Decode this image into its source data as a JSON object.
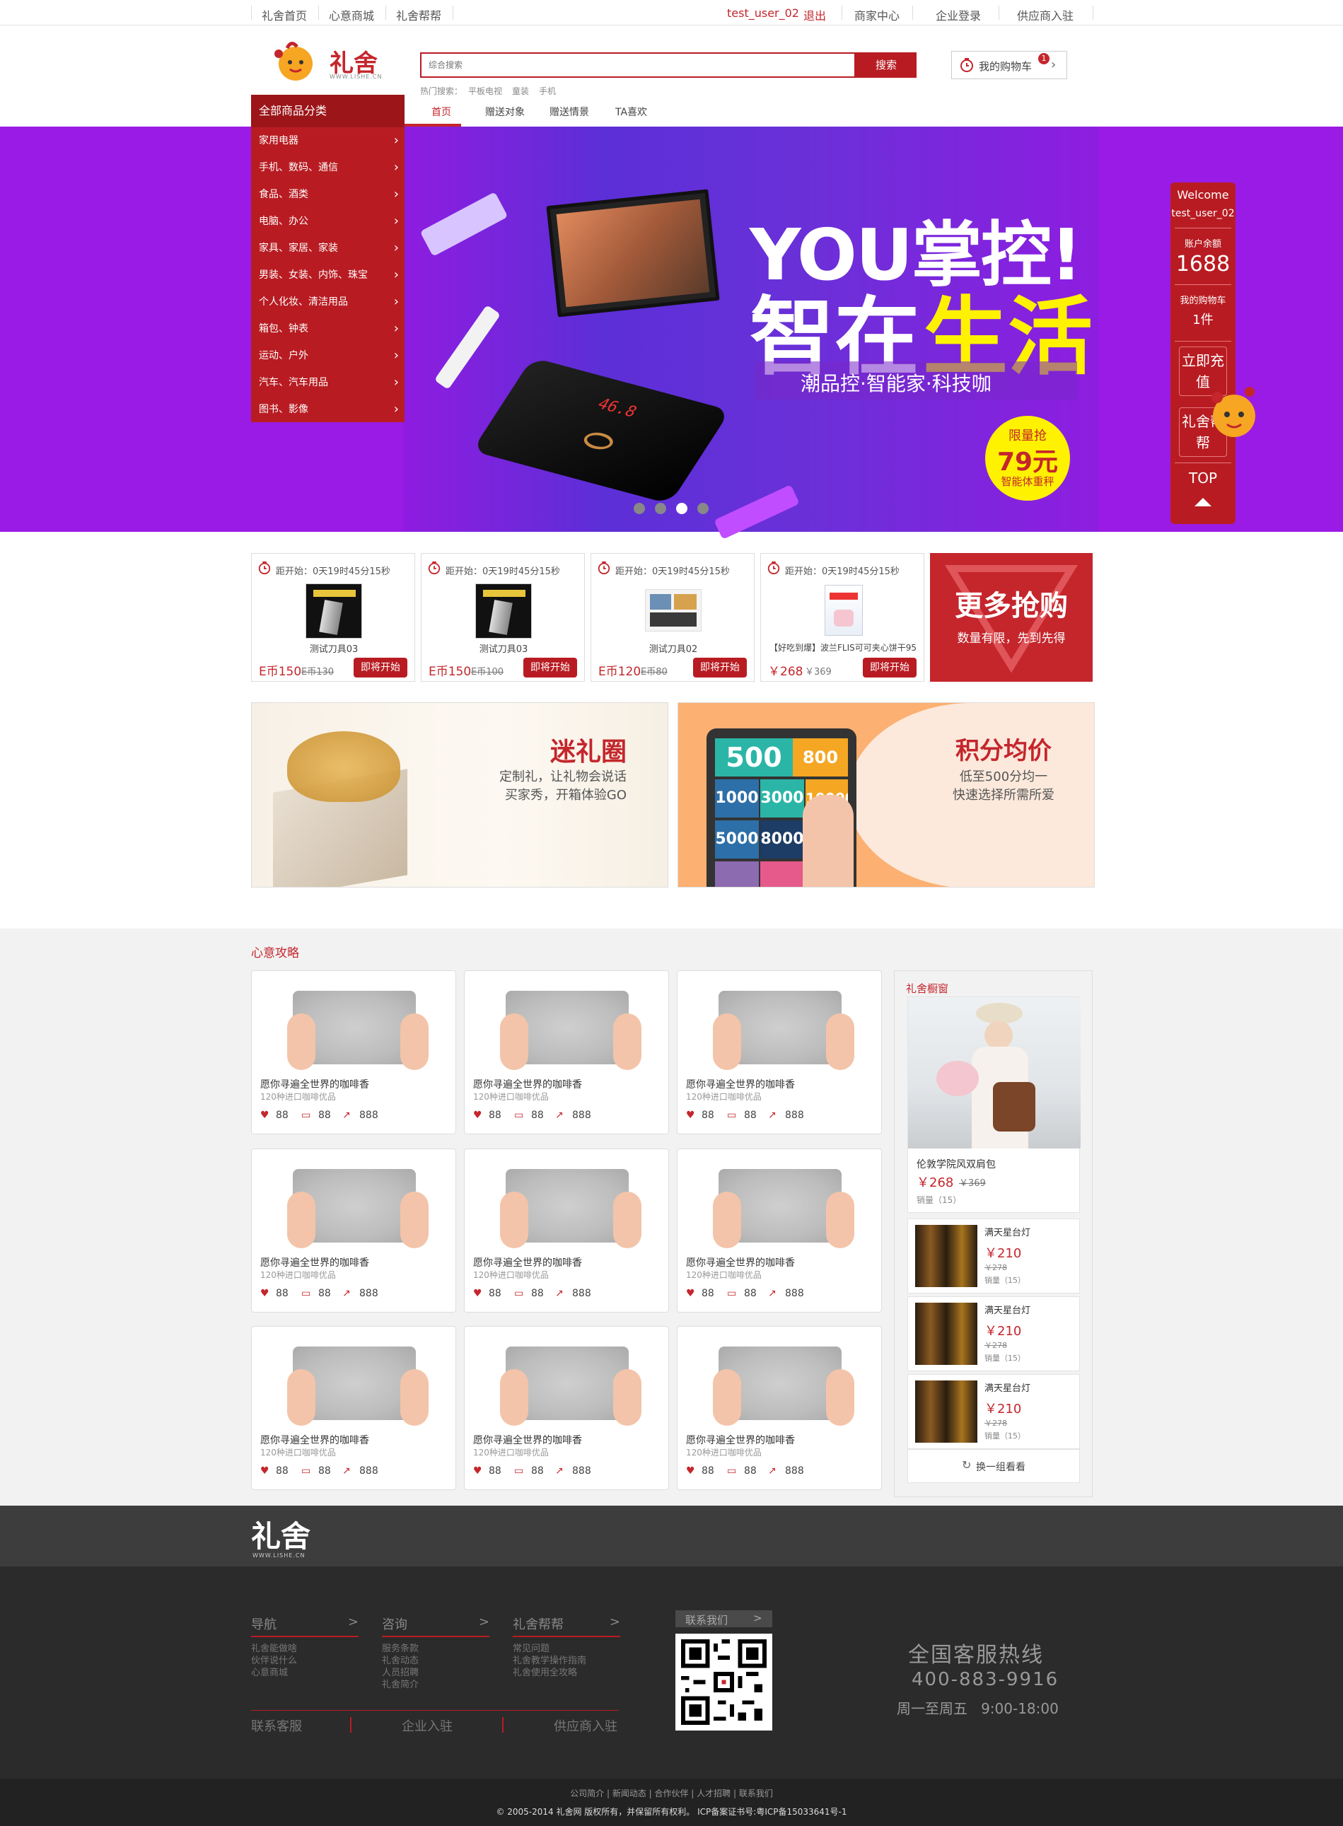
{
  "topbar": {
    "links": [
      "礼舍首页",
      "心意商城",
      "礼舍帮帮"
    ],
    "user": "test_user_02",
    "logout": "退出",
    "right_links": [
      "商家中心",
      "企业登录",
      "供应商入驻"
    ]
  },
  "header": {
    "logo_text": "礼舍",
    "logo_sub": "WWW.LISHE.CN",
    "search_placeholder": "综合搜索",
    "search_button": "搜索",
    "hot_label": "热门搜索：",
    "hot_words": [
      "平板电视",
      "童装",
      "手机"
    ],
    "cart_label": "我的购物车",
    "cart_count": "1"
  },
  "nav": {
    "category_title": "全部商品分类",
    "tabs": [
      "首页",
      "赠送对象",
      "赠送情景",
      "TA喜欢"
    ]
  },
  "categories": [
    "家用电器",
    "手机、数码、通信",
    "食品、酒类",
    "电脑、办公",
    "家具、家居、家装",
    "男装、女装、内饰、珠宝",
    "个人化妆、清洁用品",
    "箱包、钟表",
    "运动、户外",
    "汽车、汽车用品",
    "图书、影像"
  ],
  "banner": {
    "line1": "YOU掌控!",
    "line2a": "智在",
    "line2b": "生活",
    "slogan": "潮品控·智能家·科技咖",
    "badge_top": "限量抢",
    "badge_price": "79元",
    "badge_sub": "智能体重秤",
    "screen_text": "46.8"
  },
  "sidefloat": {
    "welcome": "Welcome",
    "user": "test_user_02",
    "balance_label": "账户余额",
    "balance": "1688",
    "cart_label": "我的购物车",
    "cart_count": "1件",
    "recharge": "立即充值",
    "help": "礼舍帮帮",
    "top": "TOP"
  },
  "flash_sale": {
    "items": [
      {
        "time": "距开始：0天19时45分15秒",
        "name": "测试刀具03",
        "price": "E币150",
        "old": "E币130",
        "button": "即将开始"
      },
      {
        "time": "距开始：0天19时45分15秒",
        "name": "测试刀具03",
        "price": "E币150",
        "old": "E币100",
        "button": "即将开始"
      },
      {
        "time": "距开始：0天19时45分15秒",
        "name": "测试刀具02",
        "price": "E币120",
        "old": "E币80",
        "button": "即将开始"
      },
      {
        "time": "距开始：0天19时45分15秒",
        "name": "【好吃到爆】波兰FLIS可可夹心饼干95",
        "price": "￥268",
        "old": "￥369",
        "button": "即将开始"
      }
    ],
    "more_title": "更多抢购",
    "more_sub": "数量有限，先到先得"
  },
  "promos": {
    "left_title": "迷礼圈",
    "left_line1": "定制礼，让礼物会说话",
    "left_line2": "买家秀，开箱体验GO",
    "right_title": "积分均价",
    "right_line1": "低至500分均一",
    "right_line2": "快速选择所需所爱",
    "puzzle": [
      "500",
      "800",
      "1000",
      "3000",
      "10000",
      "5000",
      "8000"
    ]
  },
  "gifts": {
    "section_title": "心意攻略",
    "title": "愿你寻遍全世界的咖啡香",
    "subtitle": "120种进口咖啡优品",
    "likes": "88",
    "comments": "88",
    "shares": "888"
  },
  "showcase": {
    "title": "礼舍橱窗",
    "main_name": "伦敦学院风双肩包",
    "main_price": "￥268",
    "main_old": "￥369",
    "main_sales": "销量（15）",
    "items": [
      {
        "name": "满天星台灯",
        "price": "￥210",
        "old": "￥278",
        "sales": "销量（15）"
      },
      {
        "name": "满天星台灯",
        "price": "￥210",
        "old": "￥278",
        "sales": "销量（15）"
      },
      {
        "name": "满天星台灯",
        "price": "￥210",
        "old": "￥278",
        "sales": "销量（15）"
      }
    ],
    "refresh": "换一组看看"
  },
  "footer": {
    "logo": "礼舍",
    "logo_sub": "WWW.LISHE.CN",
    "cols": [
      {
        "title": "导航",
        "items": [
          "礼舍能做啥",
          "伙伴说什么",
          "心意商城"
        ]
      },
      {
        "title": "咨询",
        "items": [
          "服务条款",
          "礼舍动态",
          "人员招聘",
          "礼舍简介"
        ]
      },
      {
        "title": "礼舍帮帮",
        "items": [
          "常见问题",
          "礼舍教学操作指南",
          "礼舍使用全攻略"
        ]
      }
    ],
    "bottom_links": [
      "联系客服",
      "企业入驻",
      "供应商入驻"
    ],
    "contact": "联系我们",
    "hotline_title": "全国客服热线",
    "hotline": "400-883-9916",
    "hours": "周一至周五   9:00-18:00",
    "copy_links": "公司简介 | 新闻动态 | 合作伙伴 | 人才招聘 | 联系我们",
    "copyright": "© 2005-2014 礼舍网 版权所有，并保留所有权利。 ICP备案证书号:粤ICP备15033641号-1"
  }
}
